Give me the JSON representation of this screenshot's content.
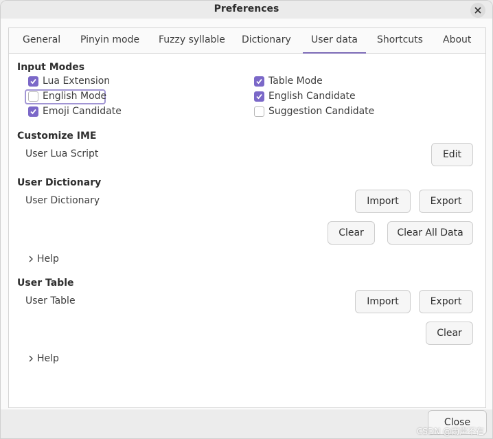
{
  "window": {
    "title": "Preferences",
    "close_button_label": "Close"
  },
  "tabs": [
    {
      "label": "General"
    },
    {
      "label": "Pinyin mode"
    },
    {
      "label": "Fuzzy syllable"
    },
    {
      "label": "Dictionary"
    },
    {
      "label": "User data",
      "active": true
    },
    {
      "label": "Shortcuts"
    },
    {
      "label": "About"
    }
  ],
  "input_modes": {
    "title": "Input Modes",
    "options": [
      {
        "label": "Lua Extension",
        "checked": true
      },
      {
        "label": "English Mode",
        "checked": false,
        "focused": true
      },
      {
        "label": "Emoji Candidate",
        "checked": true
      },
      {
        "label": "Table Mode",
        "checked": true
      },
      {
        "label": "English Candidate",
        "checked": true
      },
      {
        "label": "Suggestion Candidate",
        "checked": false
      }
    ]
  },
  "customize_ime": {
    "title": "Customize IME",
    "row_label": "User Lua Script",
    "edit_button": "Edit"
  },
  "user_dictionary": {
    "title": "User Dictionary",
    "row_label": "User Dictionary",
    "import_button": "Import",
    "export_button": "Export",
    "clear_button": "Clear",
    "clear_all_button": "Clear All Data",
    "help_label": "Help"
  },
  "user_table": {
    "title": "User Table",
    "row_label": "User Table",
    "import_button": "Import",
    "export_button": "Export",
    "clear_button": "Clear",
    "help_label": "Help"
  },
  "watermark": "CSDN @雨声不在",
  "colors": {
    "accent": "#7b68c8",
    "focus_ring": "#a195d4",
    "background": "#fafafa"
  },
  "icons": {
    "window_close": "close-icon",
    "checkbox_check": "check-icon",
    "expander": "chevron-right-icon"
  }
}
